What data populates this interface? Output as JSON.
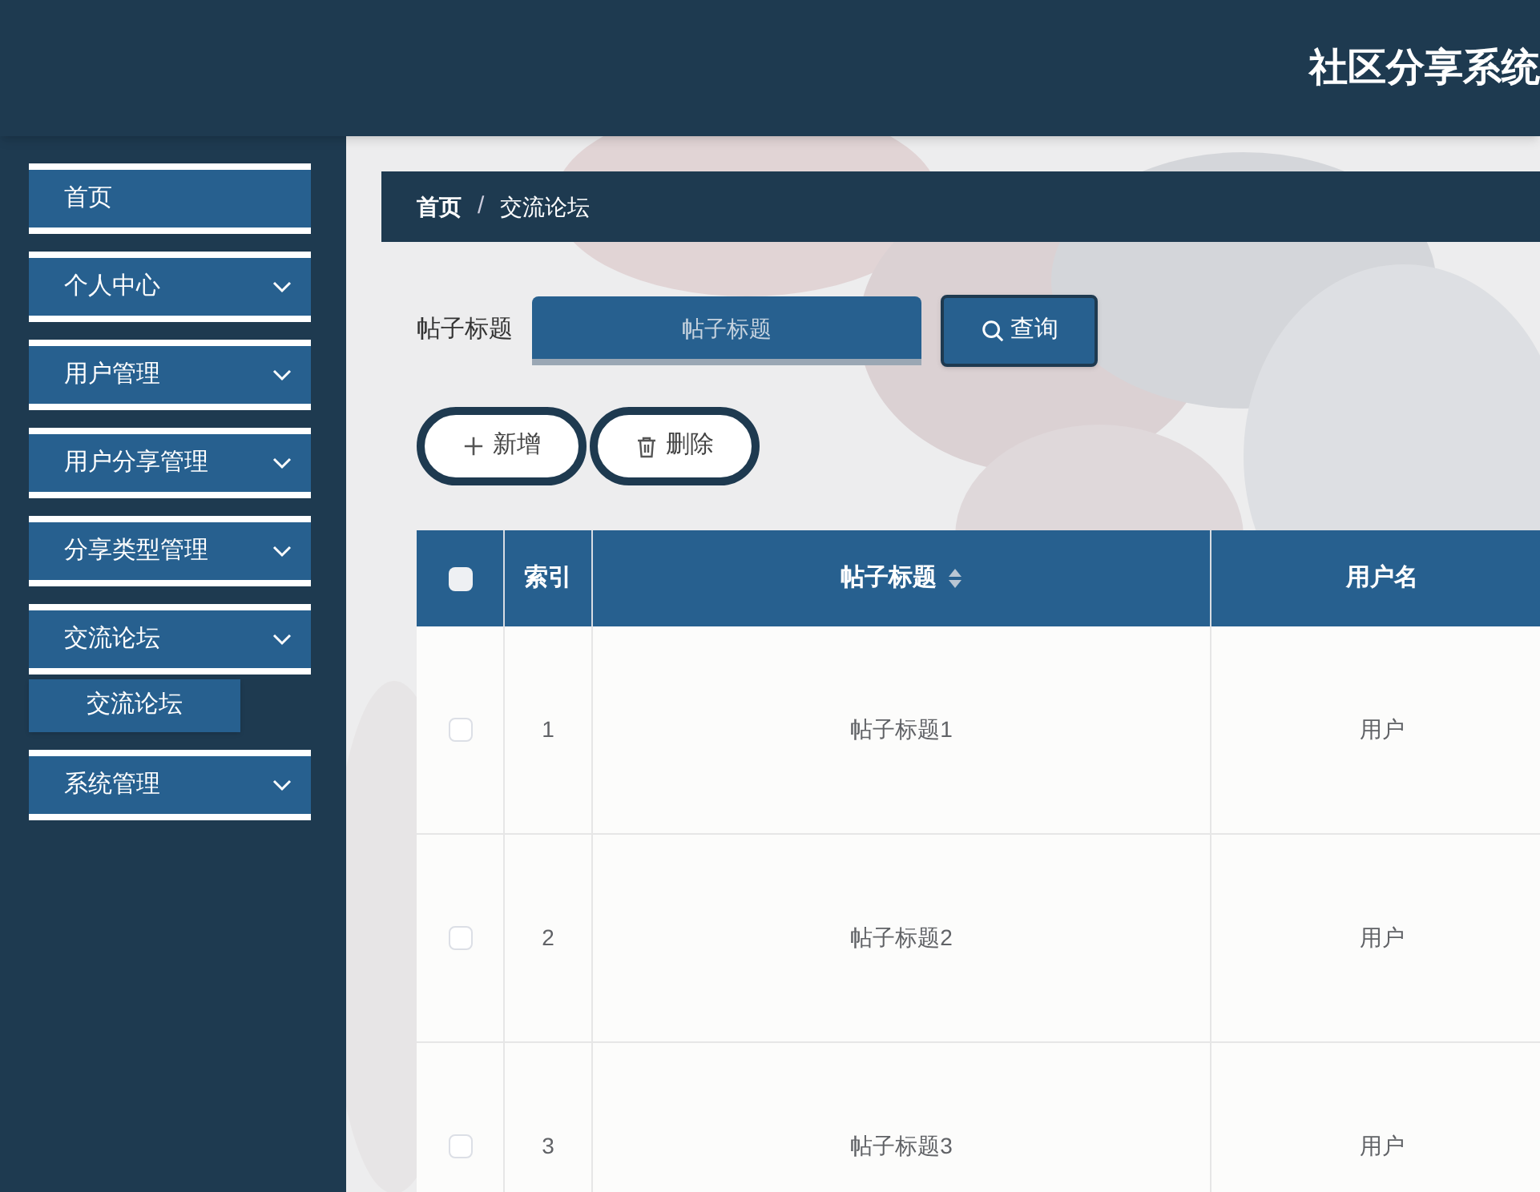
{
  "header": {
    "title": "社区分享系统"
  },
  "sidebar": {
    "items": [
      {
        "label": "首页",
        "kind": "link"
      },
      {
        "label": "个人中心",
        "kind": "menu"
      },
      {
        "label": "用户管理",
        "kind": "menu"
      },
      {
        "label": "用户分享管理",
        "kind": "menu"
      },
      {
        "label": "分享类型管理",
        "kind": "menu"
      },
      {
        "label": "交流论坛",
        "kind": "menu",
        "expanded": true,
        "children": [
          {
            "label": "交流论坛"
          }
        ]
      },
      {
        "label": "系统管理",
        "kind": "menu"
      }
    ]
  },
  "breadcrumb": {
    "separator": "/",
    "items": [
      {
        "label": "首页"
      },
      {
        "label": "交流论坛"
      }
    ]
  },
  "search": {
    "label": "帖子标题",
    "placeholder": "帖子标题",
    "button": "查询"
  },
  "actions": [
    {
      "label": "新增",
      "kind": "add"
    },
    {
      "label": "删除",
      "kind": "delete"
    }
  ],
  "table": {
    "columns": [
      {
        "kind": "checkbox",
        "checked": false
      },
      {
        "label": "索引",
        "kind": "text"
      },
      {
        "label": "帖子标题",
        "kind": "sortable"
      },
      {
        "label": "用户名",
        "kind": "text"
      }
    ],
    "rows": [
      {
        "checked": false,
        "cells": [
          "",
          "1",
          "帖子标题1",
          "用户"
        ]
      },
      {
        "checked": false,
        "cells": [
          "",
          "2",
          "帖子标题2",
          "用户"
        ]
      },
      {
        "checked": false,
        "cells": [
          "",
          "3",
          "帖子标题3",
          "用户"
        ]
      }
    ]
  }
}
